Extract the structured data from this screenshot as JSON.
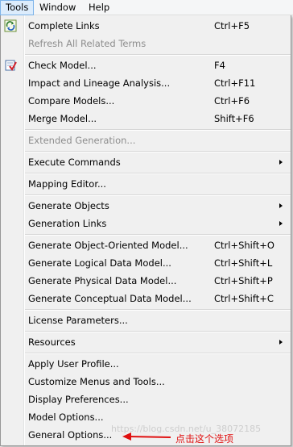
{
  "menubar": {
    "tools": "Tools",
    "window": "Window",
    "help": "Help"
  },
  "menu": {
    "complete_links": "Complete Links",
    "complete_links_shortcut": "Ctrl+F5",
    "refresh_terms": "Refresh All Related Terms",
    "check_model": "Check Model...",
    "check_model_shortcut": "F4",
    "impact_lineage": "Impact and Lineage Analysis...",
    "impact_lineage_shortcut": "Ctrl+F11",
    "compare_models": "Compare Models...",
    "compare_models_shortcut": "Ctrl+F6",
    "merge_model": "Merge Model...",
    "merge_model_shortcut": "Shift+F6",
    "extended_generation": "Extended Generation...",
    "execute_commands": "Execute Commands",
    "mapping_editor": "Mapping Editor...",
    "generate_objects": "Generate Objects",
    "generation_links": "Generation Links",
    "gen_oo_model": "Generate Object-Oriented Model...",
    "gen_oo_model_shortcut": "Ctrl+Shift+O",
    "gen_logical_model": "Generate Logical Data Model...",
    "gen_logical_model_shortcut": "Ctrl+Shift+L",
    "gen_physical_model": "Generate Physical Data Model...",
    "gen_physical_model_shortcut": "Ctrl+Shift+P",
    "gen_conceptual_model": "Generate Conceptual Data Model...",
    "gen_conceptual_model_shortcut": "Ctrl+Shift+C",
    "license_parameters": "License Parameters...",
    "resources": "Resources",
    "apply_user_profile": "Apply User Profile...",
    "customize_menus": "Customize Menus and Tools...",
    "display_preferences": "Display Preferences...",
    "model_options": "Model Options...",
    "general_options": "General Options..."
  },
  "annotation": {
    "text": "点击这个选项",
    "color": "#e01010"
  },
  "watermark": "https://blog.csdn.net/u_38072185",
  "icons": [
    "refresh-links-icon",
    "check-model-icon"
  ]
}
